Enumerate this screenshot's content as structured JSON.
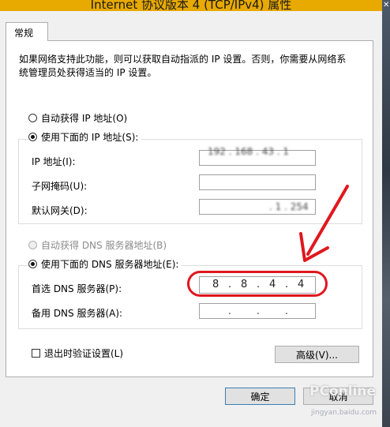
{
  "window": {
    "title": "Internet 协议版本 4 (TCP/IPv4) 属性"
  },
  "tabs": [
    {
      "label": "常规"
    }
  ],
  "description": "如果网络支持此功能，则可以获取自动指派的 IP 设置。否则，你需要从网络系统管理员处获得适当的 IP 设置。",
  "ip_section": {
    "auto_label": "自动获得 IP 地址(O)",
    "auto_selected": false,
    "manual_label": "使用下面的 IP 地址(S):",
    "manual_selected": true,
    "ip_address_label": "IP 地址(I):",
    "ip_address_value": "192 . 168 . 43 . 1",
    "subnet_label": "子网掩码(U):",
    "subnet_value": "",
    "gateway_label": "默认网关(D):",
    "gateway_value": ". 1 . 254"
  },
  "dns_section": {
    "auto_label": "自动获得 DNS 服务器地址(B)",
    "auto_selected": false,
    "auto_disabled": true,
    "manual_label": "使用下面的 DNS 服务器地址(E):",
    "manual_selected": true,
    "preferred_label": "首选 DNS 服务器(P):",
    "preferred_octets": [
      "8",
      "8",
      "4",
      "4"
    ],
    "alternate_label": "备用 DNS 服务器(A):",
    "alternate_octets": [
      "",
      "",
      "",
      ""
    ]
  },
  "validate_on_exit": {
    "label": "退出时验证设置(L)",
    "checked": false
  },
  "buttons": {
    "advanced": "高级(V)...",
    "ok": "确定",
    "cancel": "取消"
  },
  "annotation": {
    "highlight_color": "#e0171e"
  },
  "watermark": {
    "brand": "PConline",
    "url": "jingyan.baidu.com"
  }
}
